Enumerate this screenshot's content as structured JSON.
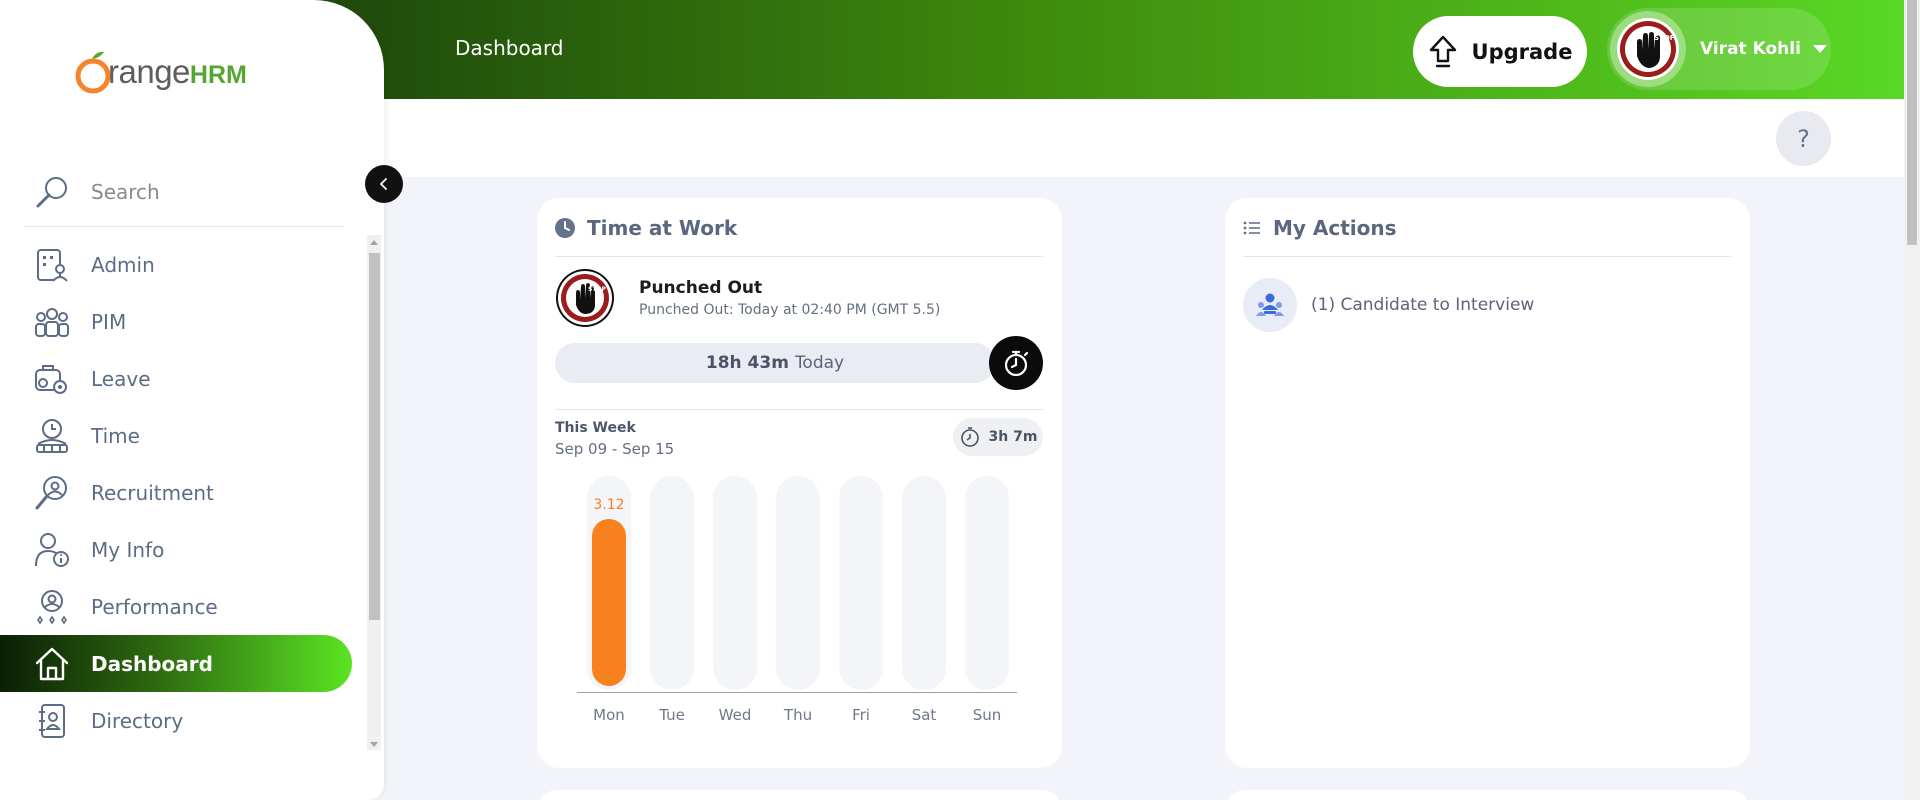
{
  "topbar": {
    "title": "Dashboard",
    "upgrade_label": "Upgrade",
    "user_name": "Virat Kohli"
  },
  "sidebar": {
    "logo_prefix": "range",
    "logo_suffix": "HRM",
    "search_label": "Search",
    "items": [
      {
        "label": "Admin",
        "icon": "admin-icon"
      },
      {
        "label": "PIM",
        "icon": "pim-icon"
      },
      {
        "label": "Leave",
        "icon": "leave-icon"
      },
      {
        "label": "Time",
        "icon": "time-icon"
      },
      {
        "label": "Recruitment",
        "icon": "recruitment-icon"
      },
      {
        "label": "My Info",
        "icon": "my-info-icon"
      },
      {
        "label": "Performance",
        "icon": "performance-icon"
      },
      {
        "label": "Dashboard",
        "icon": "home-icon",
        "active": true
      },
      {
        "label": "Directory",
        "icon": "directory-icon"
      }
    ]
  },
  "help": {
    "label": "?"
  },
  "time_at_work": {
    "title": "Time at Work",
    "status": "Punched Out",
    "detail": "Punched Out: Today at 02:40 PM (GMT 5.5)",
    "today_duration": "18h 43m",
    "today_label": "Today",
    "week_label": "This Week",
    "week_range": "Sep 09 - Sep 15",
    "week_total": "3h 7m"
  },
  "chart_data": {
    "type": "bar",
    "categories": [
      "Mon",
      "Tue",
      "Wed",
      "Thu",
      "Fri",
      "Sat",
      "Sun"
    ],
    "values": [
      3.12,
      0,
      0,
      0,
      0,
      0,
      0
    ],
    "data_labels": [
      "3.12",
      "",
      "",
      "",
      "",
      "",
      ""
    ],
    "ylim": [
      0,
      4
    ],
    "bar_color": "#f7801f",
    "track_color": "#f4f5f9"
  },
  "my_actions": {
    "title": "My Actions",
    "items": [
      {
        "label": "(1) Candidate to Interview",
        "icon": "candidate-icon"
      }
    ]
  },
  "colors": {
    "accent_orange": "#f7801f",
    "topbar_dark": "#0d2506",
    "topbar_light": "#5ad825"
  }
}
